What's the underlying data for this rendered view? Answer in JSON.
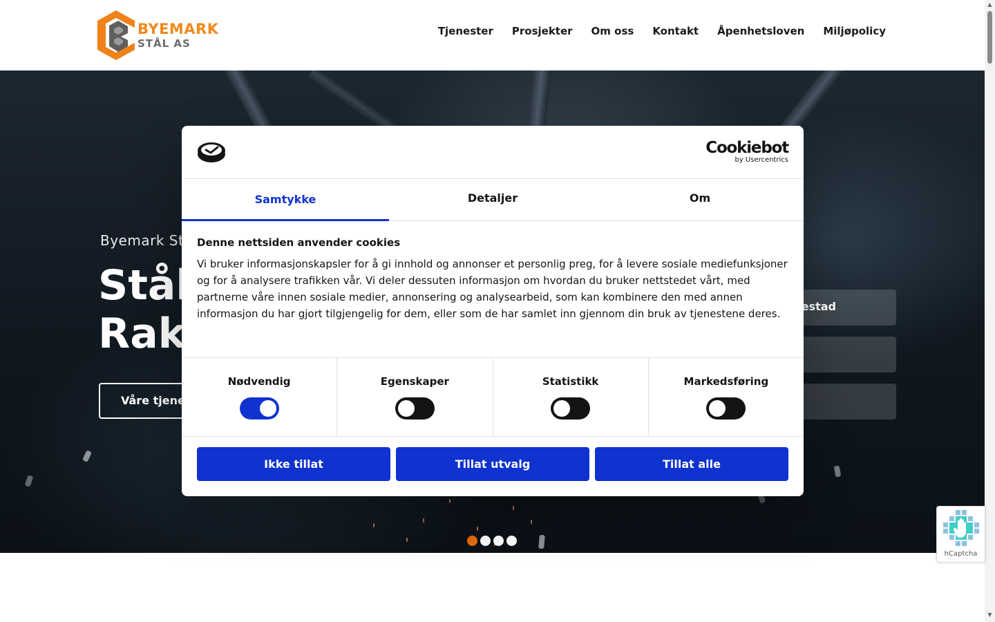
{
  "header": {
    "logo": {
      "line1": "BYEMARK",
      "line2": "STÅL AS"
    },
    "nav": [
      "Tjenester",
      "Prosjekter",
      "Om oss",
      "Kontakt",
      "Åpenhetsloven",
      "Miljøpolicy"
    ]
  },
  "hero": {
    "overline": "Byemark St",
    "title_line1": "Stål",
    "title_line2": "Rak",
    "cta": "Våre tjenes",
    "cards": [
      "estad",
      "",
      ""
    ],
    "slides": {
      "count": 4,
      "active": 1
    }
  },
  "cookie": {
    "brand": {
      "name": "Cookiebot",
      "by": "by Usercentrics"
    },
    "tabs": [
      "Samtykke",
      "Detaljer",
      "Om"
    ],
    "active_tab": 0,
    "heading": "Denne nettsiden anvender cookies",
    "text": "Vi bruker informasjonskapsler for å gi innhold og annonser et personlig preg, for å levere sosiale mediefunksjoner og for å analysere trafikken vår. Vi deler dessuten informasjon om hvordan du bruker nettstedet vårt, med partnerne våre innen sosiale medier, annonsering og analysearbeid, som kan kombinere den med annen informasjon du har gjort tilgjengelig for dem, eller som de har samlet inn gjennom din bruk av tjenestene deres.",
    "categories": [
      {
        "label": "Nødvendig",
        "enabled": true
      },
      {
        "label": "Egenskaper",
        "enabled": false
      },
      {
        "label": "Statistikk",
        "enabled": false
      },
      {
        "label": "Markedsføring",
        "enabled": false
      }
    ],
    "buttons": {
      "deny": "Ikke tillat",
      "selection": "Tillat utvalg",
      "all": "Tillat alle"
    }
  },
  "captcha": {
    "label": "hCaptcha"
  },
  "colors": {
    "accent_blue": "#1032cf",
    "brand_orange": "#f08a1c",
    "slide_active": "#ea6d0c"
  }
}
